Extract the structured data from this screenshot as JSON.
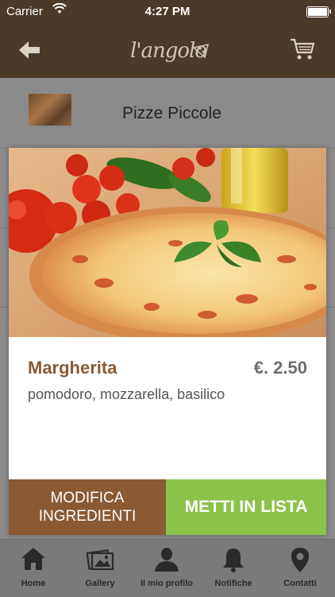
{
  "status_bar": {
    "carrier": "Carrier",
    "time": "4:27 PM"
  },
  "nav": {
    "logo_text": "l'angolo"
  },
  "category": {
    "title": "Pizze Piccole"
  },
  "product": {
    "name": "Margherita",
    "price": "€. 2.50",
    "ingredients": "pomodoro, mozzarella, basilico"
  },
  "actions": {
    "modify": "MODIFICA INGREDIENTI",
    "add": "METTI IN LISTA"
  },
  "tabs": [
    {
      "label": "Home",
      "icon": "home-icon"
    },
    {
      "label": "Gallery",
      "icon": "gallery-icon"
    },
    {
      "label": "Il mio profilo",
      "icon": "profile-icon"
    },
    {
      "label": "Notifiche",
      "icon": "bell-icon"
    },
    {
      "label": "Contatti",
      "icon": "location-pin-icon"
    }
  ],
  "colors": {
    "header": "#4a3a2a",
    "brown": "#8a5a34",
    "green": "#8bc34a",
    "overlay": "#808080"
  }
}
